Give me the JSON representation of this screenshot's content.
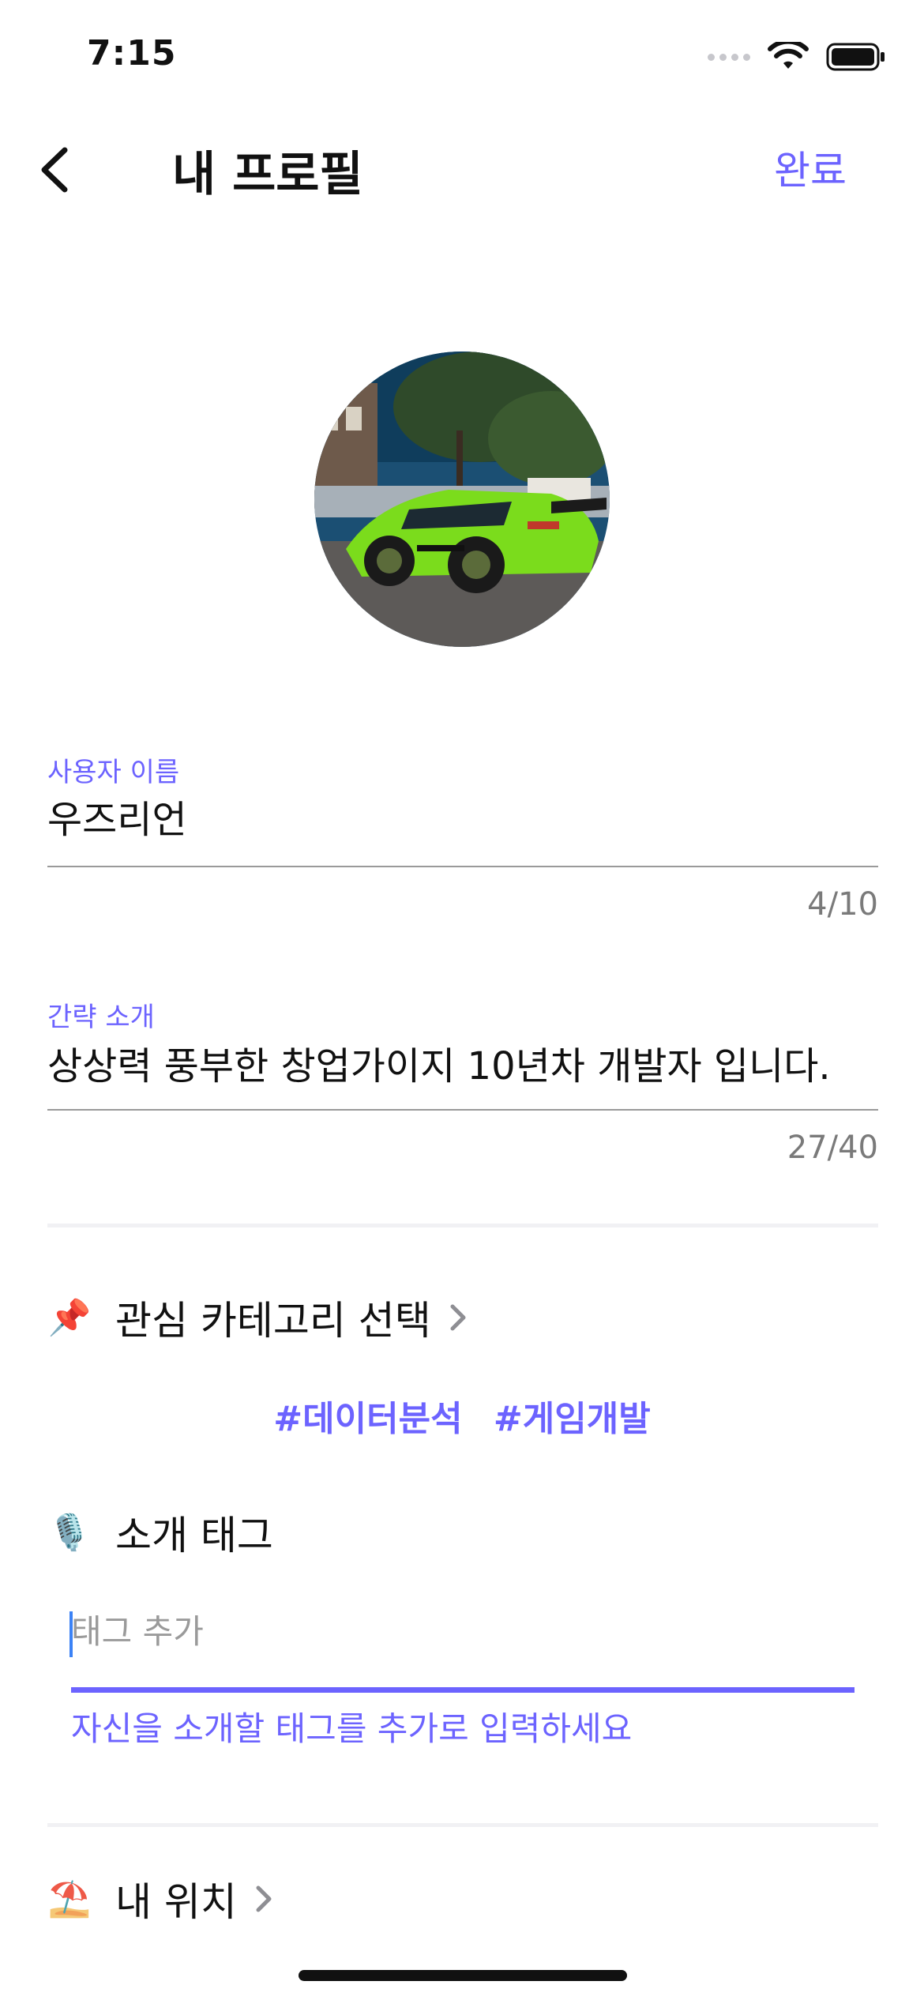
{
  "status_bar": {
    "time": "7:15"
  },
  "nav": {
    "title": "내 프로필",
    "done_label": "완료"
  },
  "profile": {
    "username_label": "사용자 이름",
    "username_value": "우즈리언",
    "username_counter": "4/10",
    "bio_label": "간략 소개",
    "bio_value": "상상력 풍부한 창업가이지 10년차 개발자 입니다.",
    "bio_counter": "27/40"
  },
  "interests": {
    "emoji": "📌",
    "label": "관심 카테고리 선택",
    "tags": [
      "#데이터분석",
      "#게임개발"
    ]
  },
  "intro_tags": {
    "emoji": "🎙️",
    "label": "소개 태그",
    "placeholder": "태그 추가",
    "helper": "자신을 소개할 태그를 추가로 입력하세요"
  },
  "location": {
    "emoji": "⛱️",
    "label": "내 위치"
  },
  "colors": {
    "accent": "#6c63ff",
    "car": "#7bdc1c"
  }
}
